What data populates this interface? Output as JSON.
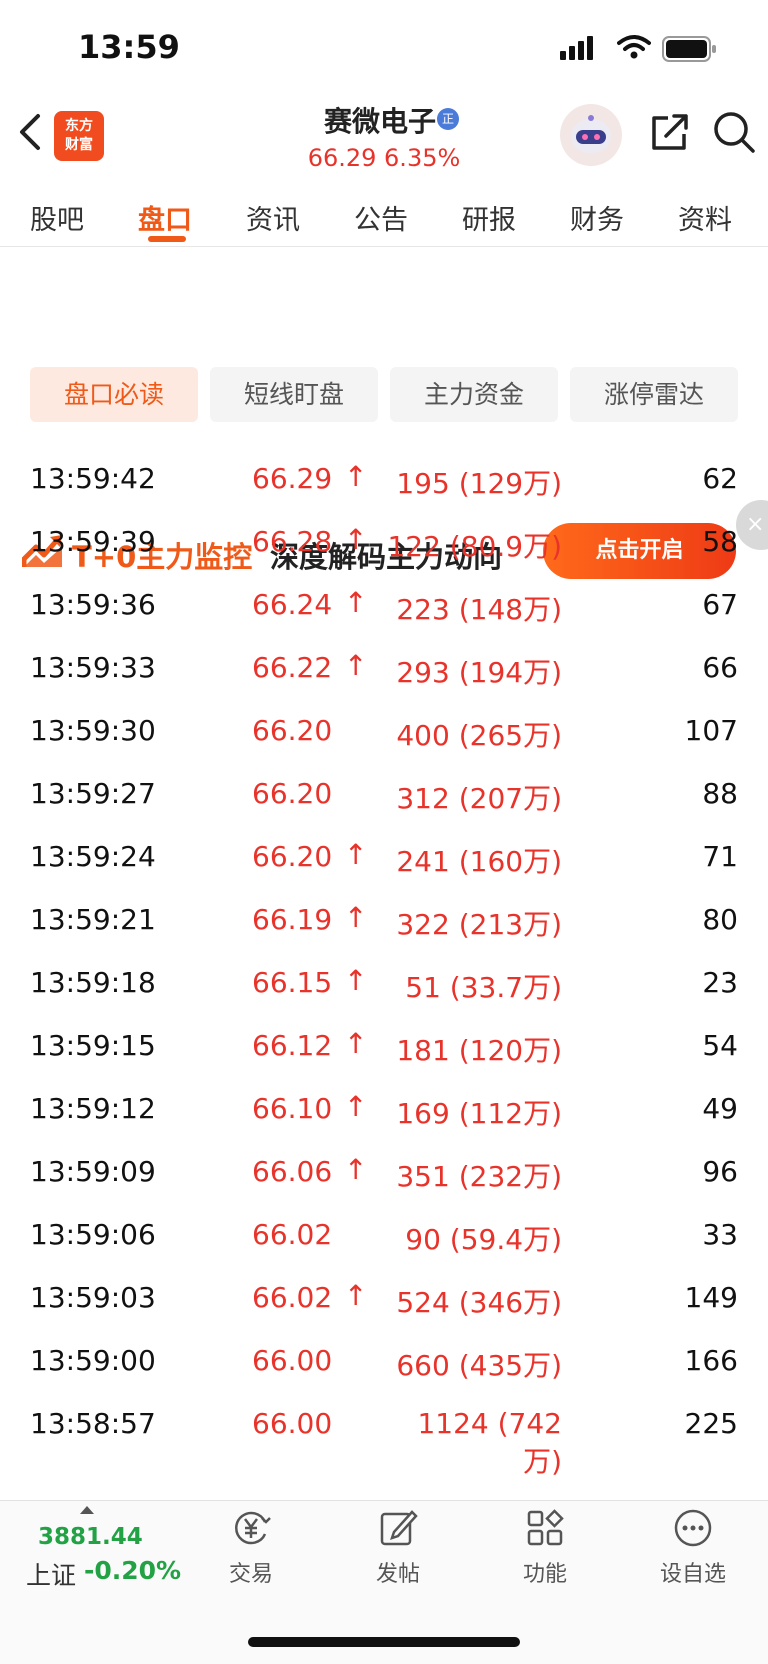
{
  "status_bar": {
    "time": "13:59"
  },
  "header": {
    "logo_line1": "东方",
    "logo_line2": "财富",
    "stock_name": "赛微电子",
    "verify_badge": "正",
    "price_line": "66.29  6.35%"
  },
  "tabs": [
    {
      "label": "股吧"
    },
    {
      "label": "盘口"
    },
    {
      "label": "资讯"
    },
    {
      "label": "公告"
    },
    {
      "label": "研报"
    },
    {
      "label": "财务"
    },
    {
      "label": "资料"
    }
  ],
  "banner": {
    "title": "T+0主力监控",
    "subtitle": "深度解码主力动向",
    "cta": "点击开启",
    "close": "×"
  },
  "segments": [
    {
      "label": "盘口必读"
    },
    {
      "label": "短线盯盘"
    },
    {
      "label": "主力资金"
    },
    {
      "label": "涨停雷达"
    }
  ],
  "trades": [
    {
      "time": "13:59:42",
      "price": "66.29",
      "arrow": "↑",
      "volume": "195 (129万)",
      "count": "62"
    },
    {
      "time": "13:59:39",
      "price": "66.28",
      "arrow": "↑",
      "volume": "122 (80.9万)",
      "count": "58"
    },
    {
      "time": "13:59:36",
      "price": "66.24",
      "arrow": "↑",
      "volume": "223 (148万)",
      "count": "67"
    },
    {
      "time": "13:59:33",
      "price": "66.22",
      "arrow": "↑",
      "volume": "293 (194万)",
      "count": "66"
    },
    {
      "time": "13:59:30",
      "price": "66.20",
      "arrow": "",
      "volume": "400 (265万)",
      "count": "107"
    },
    {
      "time": "13:59:27",
      "price": "66.20",
      "arrow": "",
      "volume": "312 (207万)",
      "count": "88"
    },
    {
      "time": "13:59:24",
      "price": "66.20",
      "arrow": "↑",
      "volume": "241 (160万)",
      "count": "71"
    },
    {
      "time": "13:59:21",
      "price": "66.19",
      "arrow": "↑",
      "volume": "322 (213万)",
      "count": "80"
    },
    {
      "time": "13:59:18",
      "price": "66.15",
      "arrow": "↑",
      "volume": "51 (33.7万)",
      "count": "23"
    },
    {
      "time": "13:59:15",
      "price": "66.12",
      "arrow": "↑",
      "volume": "181 (120万)",
      "count": "54"
    },
    {
      "time": "13:59:12",
      "price": "66.10",
      "arrow": "↑",
      "volume": "169 (112万)",
      "count": "49"
    },
    {
      "time": "13:59:09",
      "price": "66.06",
      "arrow": "↑",
      "volume": "351 (232万)",
      "count": "96"
    },
    {
      "time": "13:59:06",
      "price": "66.02",
      "arrow": "",
      "volume": "90 (59.4万)",
      "count": "33"
    },
    {
      "time": "13:59:03",
      "price": "66.02",
      "arrow": "↑",
      "volume": "524 (346万)",
      "count": "149"
    },
    {
      "time": "13:59:00",
      "price": "66.00",
      "arrow": "",
      "volume": "660 (435万)",
      "count": "166"
    },
    {
      "time": "13:58:57",
      "price": "66.00",
      "arrow": "",
      "volume": "1124 (742万)",
      "count": "225"
    }
  ],
  "bottom_bar": {
    "index_value": "3881.44",
    "index_name": "上证",
    "index_change": "-0.20%",
    "nav": [
      {
        "label": "交易",
        "icon": "trade-yen-icon"
      },
      {
        "label": "发帖",
        "icon": "edit-post-icon"
      },
      {
        "label": "功能",
        "icon": "grid-apps-icon"
      },
      {
        "label": "设自选",
        "icon": "more-dots-icon"
      }
    ]
  },
  "colors": {
    "accent": "#f05a19",
    "up": "#e8332b",
    "down": "#22a244"
  }
}
